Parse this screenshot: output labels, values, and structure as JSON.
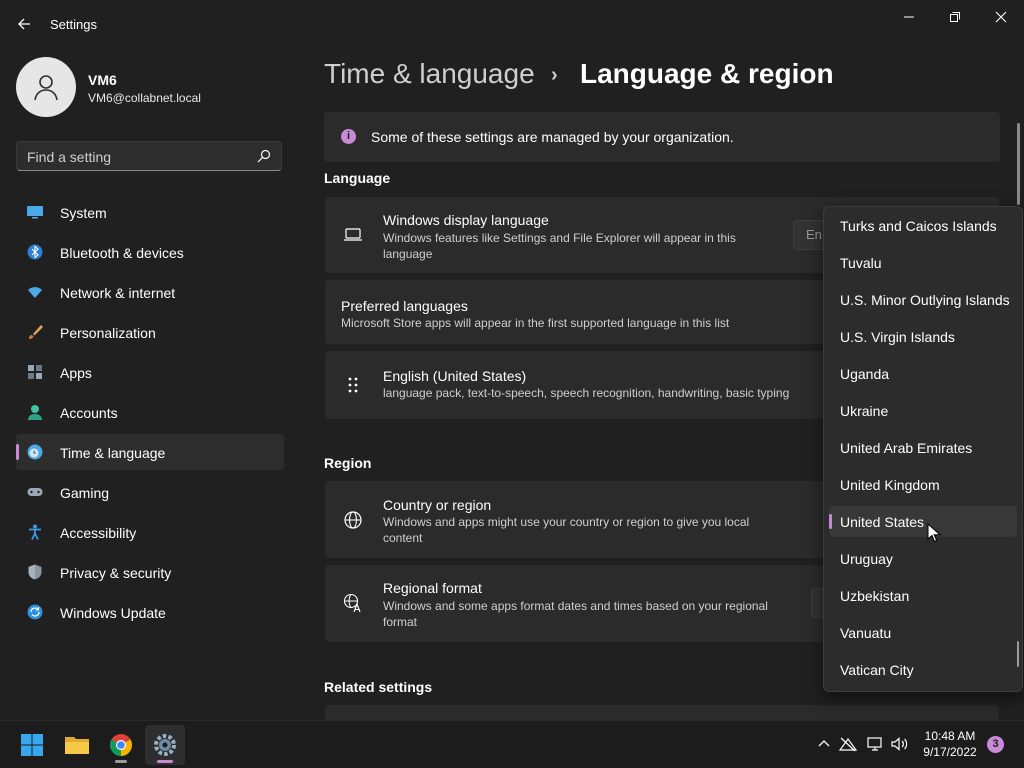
{
  "window": {
    "title": "Settings",
    "back_icon": "back-arrow-icon",
    "controls": [
      "minimize-icon",
      "restore-icon",
      "close-icon"
    ]
  },
  "user": {
    "name": "VM6",
    "email": "VM6@collabnet.local"
  },
  "search": {
    "placeholder": "Find a setting"
  },
  "sidebar": {
    "items": [
      {
        "label": "System",
        "icon": "system-icon"
      },
      {
        "label": "Bluetooth & devices",
        "icon": "bluetooth-icon"
      },
      {
        "label": "Network & internet",
        "icon": "wifi-icon"
      },
      {
        "label": "Personalization",
        "icon": "brush-icon"
      },
      {
        "label": "Apps",
        "icon": "apps-icon"
      },
      {
        "label": "Accounts",
        "icon": "accounts-icon"
      },
      {
        "label": "Time & language",
        "icon": "clock-globe-icon",
        "active": true
      },
      {
        "label": "Gaming",
        "icon": "gamepad-icon"
      },
      {
        "label": "Accessibility",
        "icon": "accessibility-icon"
      },
      {
        "label": "Privacy & security",
        "icon": "shield-icon"
      },
      {
        "label": "Windows Update",
        "icon": "update-icon"
      }
    ]
  },
  "breadcrumb": {
    "parent": "Time & language",
    "separator": "›",
    "current": "Language & region"
  },
  "banner": {
    "text": "Some of these settings are managed by your organization."
  },
  "sections": {
    "language": "Language",
    "region": "Region",
    "related": "Related settings"
  },
  "cards": {
    "display_language": {
      "title": "Windows display language",
      "desc": "Windows features like Settings and File Explorer will appear in this language",
      "value_stub": "En"
    },
    "preferred_languages": {
      "title": "Preferred languages",
      "desc": "Microsoft Store apps will appear in the first supported language in this list"
    },
    "english_us": {
      "title": "English (United States)",
      "desc": "language pack, text-to-speech, speech recognition, handwriting, basic typing"
    },
    "country_region": {
      "title": "Country or region",
      "desc": "Windows and apps might use your country or region to give you local content"
    },
    "regional_format": {
      "title": "Regional format",
      "desc": "Windows and some apps format dates and times based on your regional format"
    }
  },
  "country_dropdown": {
    "items": [
      "Turks and Caicos Islands",
      "Tuvalu",
      "U.S. Minor Outlying Islands",
      "U.S. Virgin Islands",
      "Uganda",
      "Ukraine",
      "United Arab Emirates",
      "United Kingdom",
      "United States",
      "Uruguay",
      "Uzbekistan",
      "Vanuatu",
      "Vatican City"
    ],
    "selected": "United States"
  },
  "taskbar": {
    "apps": [
      "start-icon",
      "file-explorer-icon",
      "chrome-icon",
      "settings-icon"
    ],
    "tray": [
      "chevron-up-icon",
      "network-off-icon",
      "display-icon",
      "volume-icon"
    ],
    "time": "10:48 AM",
    "date": "9/17/2022",
    "notification_count": "3"
  },
  "colors": {
    "accent": "#c88ad6",
    "background": "#202020",
    "card": "#2b2b2b"
  }
}
